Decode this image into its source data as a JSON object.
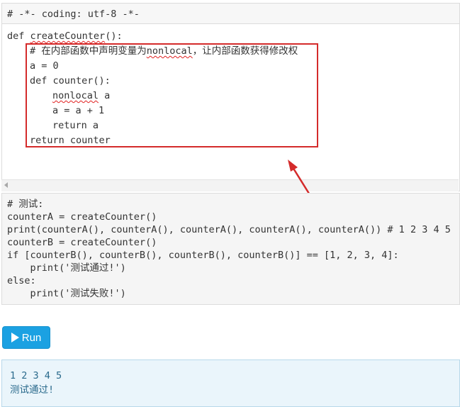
{
  "header_cell": {
    "line": "# -*- coding: utf-8 -*-"
  },
  "editor": {
    "def_line_prefix": "def ",
    "def_name": "createCounter",
    "def_line_suffix": "():",
    "comment_part1": "# 在内部函数中声明变量为",
    "comment_keyword": "nonlocal",
    "comment_part2": "，让内部函数获得修改权",
    "line_a0": "a = 0",
    "line_def_counter": "def counter():",
    "line_nonlocal": "nonlocal",
    "line_nonlocal_var": " a",
    "line_a_inc": "a = a + 1",
    "line_return_a": "return a",
    "line_return_counter": "return counter"
  },
  "test_cell": {
    "lines": [
      "# 测试:",
      "counterA = createCounter()",
      "print(counterA(), counterA(), counterA(), counterA(), counterA()) # 1 2 3 4 5",
      "counterB = createCounter()",
      "if [counterB(), counterB(), counterB(), counterB()] == [1, 2, 3, 4]:",
      "    print('测试通过!')",
      "else:",
      "    print('测试失败!')"
    ]
  },
  "run_button": {
    "label": "Run",
    "icon": "play-icon",
    "color": "#1ba1e2"
  },
  "output": {
    "lines": [
      "1 2 3 4 5",
      "测试通过!"
    ]
  },
  "annotation": {
    "box_color": "#d42b2b",
    "arrow_color": "#d42b2b"
  }
}
